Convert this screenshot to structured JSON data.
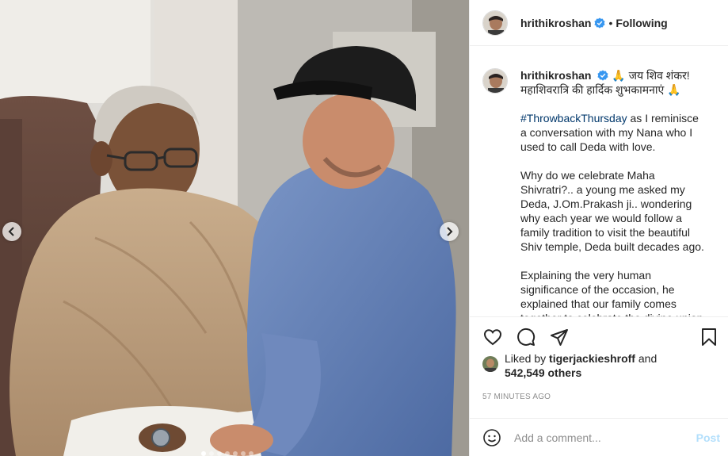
{
  "post": {
    "username": "hrithikroshan",
    "follow_state": "Following",
    "separator": "•",
    "caption": {
      "line1": "जय शिव शंकर! ",
      "line1_emoji": "🙏",
      "line2": "महाशिवरात्रि की हार्दिक शुभकामनाएं ",
      "line2_emoji": "🙏",
      "hashtag": "#ThrowbackThursday",
      "para1_rest": " as I reminisce a conversation with my Nana who I used to call Deda with love.",
      "para2": "Why do we celebrate Maha Shivratri?.. a young me asked my Deda, J.Om.Prakash ji.. wondering why each year we would follow a family tradition to visit the beautiful Shiv temple, Deda built decades ago.",
      "para3": "Explaining the very human significance of the occasion, he explained that our family comes together to celebrate the divine union of Lord Shiva and Goddess Parvati."
    },
    "likes": {
      "prefix": "Liked by ",
      "liker": "tigerjackieshroff",
      "middle": " and",
      "count": "542,549 others"
    },
    "timestamp": "57 MINUTES AGO",
    "comment": {
      "placeholder": "Add a comment...",
      "post_label": "Post"
    },
    "carousel": {
      "dots": 7,
      "active_index": 0
    }
  },
  "icons": {
    "verified": "verified-badge-icon",
    "like": "heart-icon",
    "comment": "comment-icon",
    "share": "share-icon",
    "save": "bookmark-icon",
    "emoji": "emoji-icon",
    "prev": "chevron-left-icon",
    "next": "chevron-right-icon"
  },
  "colors": {
    "verified": "#3897f0",
    "hashtag": "#00376b",
    "post_button": "#b2dffc",
    "muted": "#8e8e8e"
  }
}
